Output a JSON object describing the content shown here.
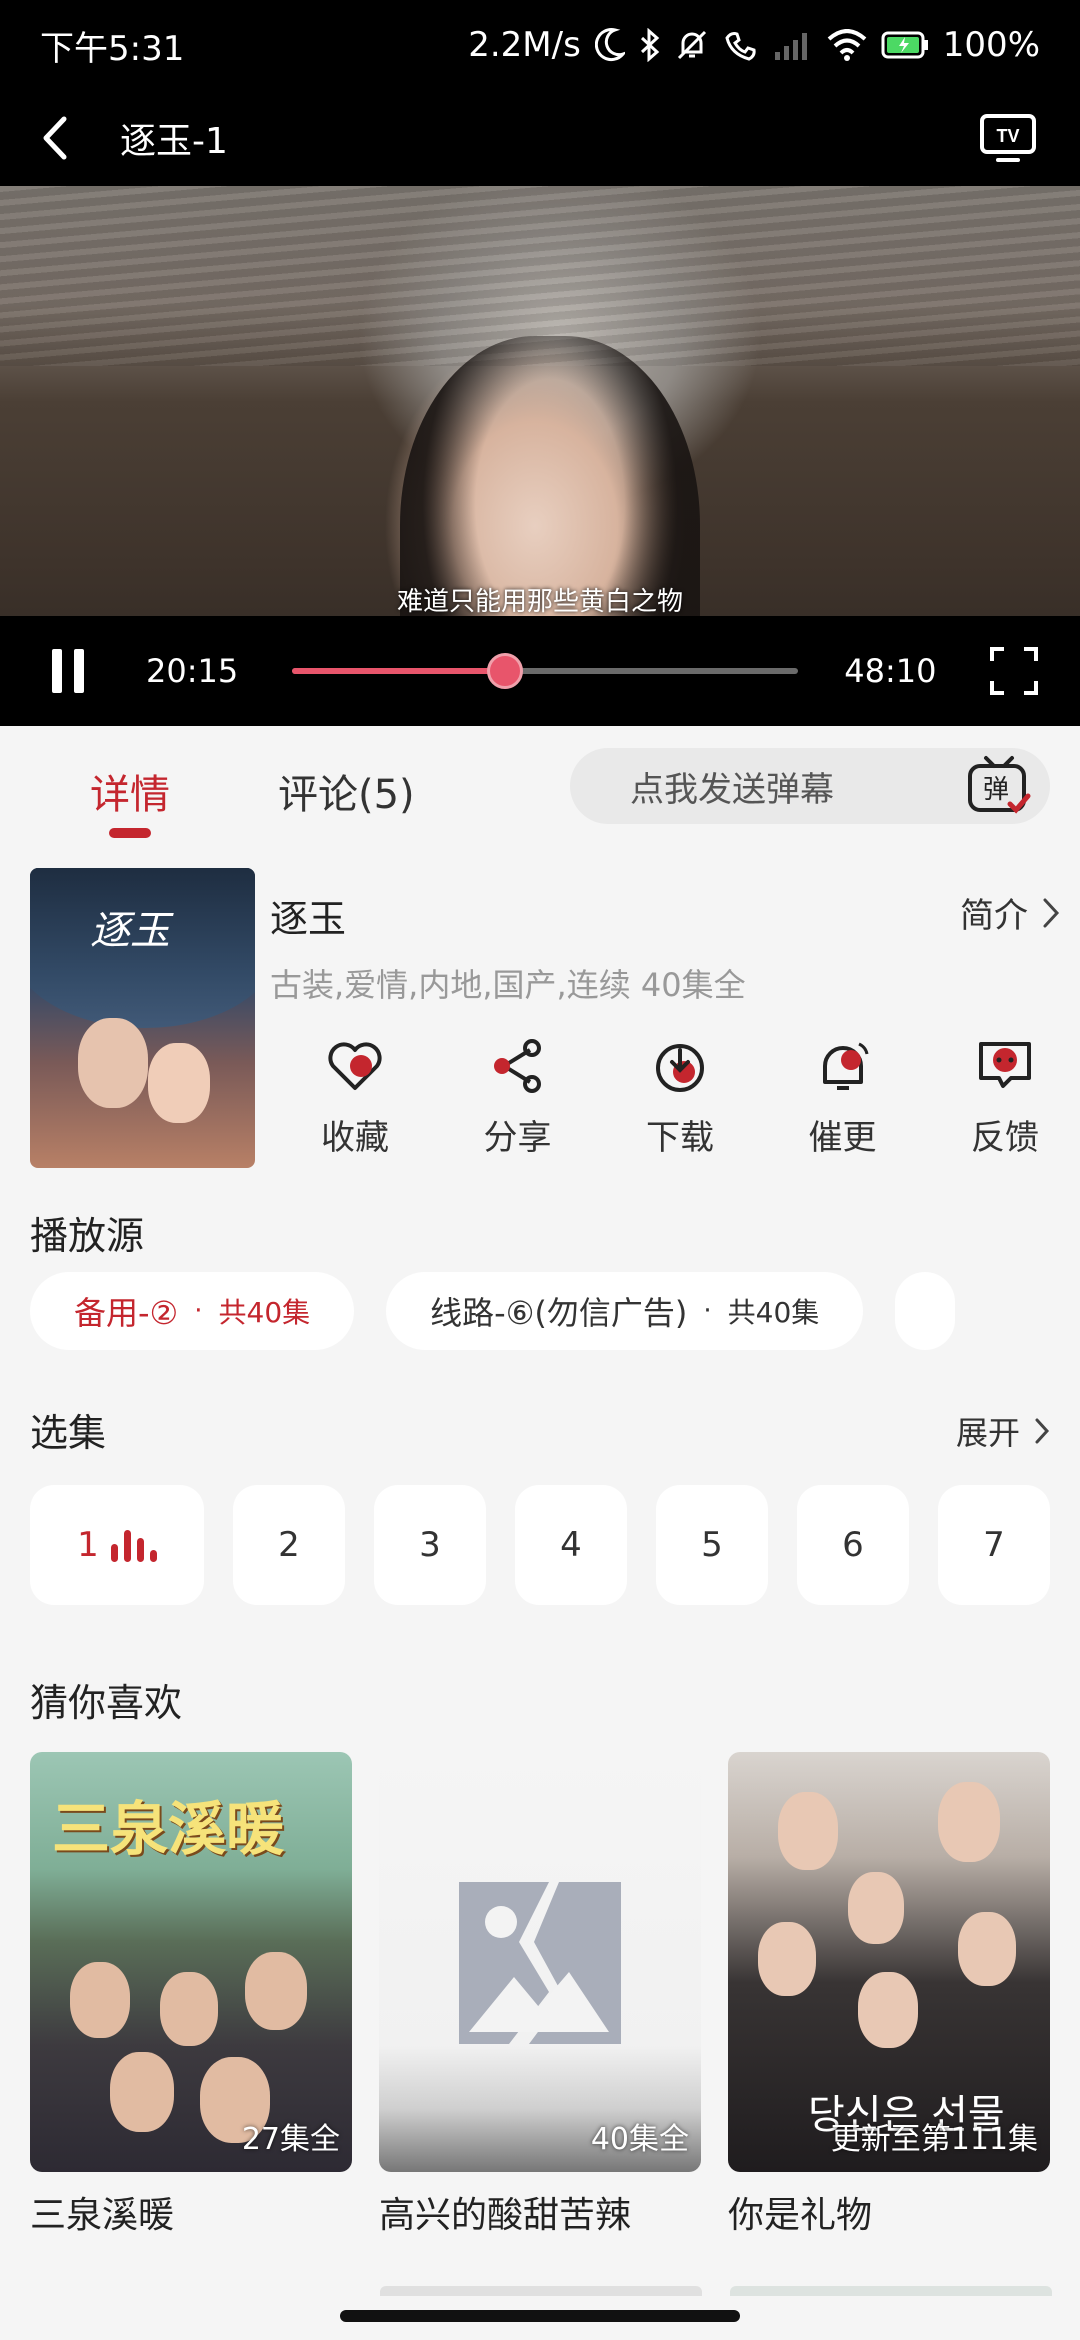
{
  "status_bar": {
    "time": "下午5:31",
    "net_speed": "2.2M/s",
    "battery": "100%"
  },
  "header": {
    "title": "逐玉-1",
    "back_icon": "chevron-left-icon",
    "cast_icon": "tv-cast-icon",
    "cast_label": "TV"
  },
  "player": {
    "subtitle": "难道只能用那些黄白之物",
    "current_time": "20:15",
    "total_time": "48:10",
    "progress": 0.42,
    "accent": "#e8556b"
  },
  "tabs": [
    {
      "label": "详情",
      "active": true
    },
    {
      "label": "评论(5)",
      "active": false
    }
  ],
  "danmu": {
    "placeholder": "点我发送弹幕",
    "icon_text": "弹"
  },
  "details": {
    "title": "逐玉",
    "poster_title": "逐玉",
    "brief_label": "简介",
    "tags": "古装,爱情,内地,国产,连续 40集全",
    "actions": [
      {
        "label": "收藏",
        "icon": "heart-icon"
      },
      {
        "label": "分享",
        "icon": "share-icon"
      },
      {
        "label": "下载",
        "icon": "download-icon"
      },
      {
        "label": "催更",
        "icon": "bell-icon"
      },
      {
        "label": "反馈",
        "icon": "feedback-icon"
      }
    ]
  },
  "play_source": {
    "title": "播放源",
    "sources": [
      {
        "name": "备用-②",
        "dot": "·",
        "count": "共40集",
        "active": true
      },
      {
        "name": "线路-⑥(勿信广告)",
        "dot": "·",
        "count": "共40集",
        "active": false
      }
    ]
  },
  "episodes": {
    "title": "选集",
    "expand_label": "展开",
    "items": [
      "1",
      "2",
      "3",
      "4",
      "5",
      "6",
      "7"
    ],
    "current": "1"
  },
  "recommendations": {
    "title": "猜你喜欢",
    "items": [
      {
        "title": "三泉溪暖",
        "badge": "27集全",
        "cover_title": "三泉溪暖"
      },
      {
        "title": "高兴的酸甜苦辣",
        "badge": "40集全"
      },
      {
        "title": "你是礼物",
        "badge": "更新至第111集",
        "cover_title": "당신은 선물"
      }
    ]
  },
  "colors": {
    "accent": "#c4262e",
    "background": "#f5f5f5"
  }
}
